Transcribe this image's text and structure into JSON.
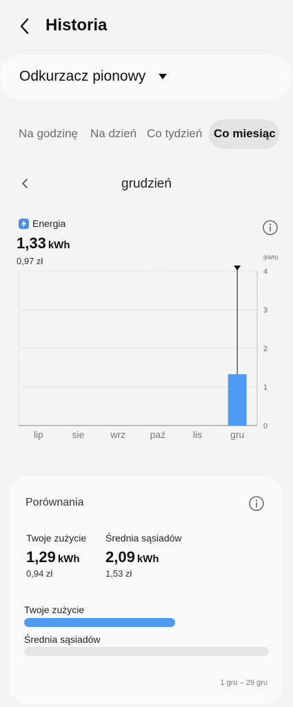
{
  "header": {
    "title": "Historia",
    "back_icon": "chevron-left-icon"
  },
  "device": {
    "name": "Odkurzacz pionowy",
    "caret_icon": "caret-down-icon"
  },
  "tabs": [
    {
      "label": "Na godzinę",
      "active": false
    },
    {
      "label": "Na dzień",
      "active": false
    },
    {
      "label": "Co tydzień",
      "active": false
    },
    {
      "label": "Co miesiąc",
      "active": true
    }
  ],
  "period": {
    "label": "grudzień",
    "prev_icon": "chevron-left-icon"
  },
  "energy": {
    "label": "Energia",
    "value": "1,33",
    "unit": "kWh",
    "cost": "0,97 zł"
  },
  "colors": {
    "accent": "#4f9af5",
    "background": "#f4f4f4",
    "card": "#fafafa"
  },
  "chart_data": {
    "type": "bar",
    "categories": [
      "lip",
      "sie",
      "wrz",
      "paź",
      "lis",
      "gru"
    ],
    "values": [
      0,
      0,
      0,
      0,
      0,
      1.33
    ],
    "y_unit_label": "(kWh)",
    "y_ticks": [
      "0",
      "1",
      "2",
      "3",
      "4"
    ],
    "ylim": [
      0,
      4
    ],
    "selected_index": 5,
    "grid": true,
    "y_axis_side": "right"
  },
  "comparison": {
    "title": "Porównania",
    "yours": {
      "label": "Twoje zużycie",
      "value": "1,29",
      "unit": "kWh",
      "cost": "0,94 zł",
      "bar_fraction": 0.617
    },
    "neighbors": {
      "label": "Średnia sąsiadów",
      "value": "2,09",
      "unit": "kWh",
      "cost": "1,53 zł",
      "bar_fraction": 1.0
    },
    "bars": {
      "yours_label": "Twoje zużycie",
      "neighbors_label": "Średnia sąsiadów"
    },
    "date_range": "1 gru – 29 gru"
  }
}
